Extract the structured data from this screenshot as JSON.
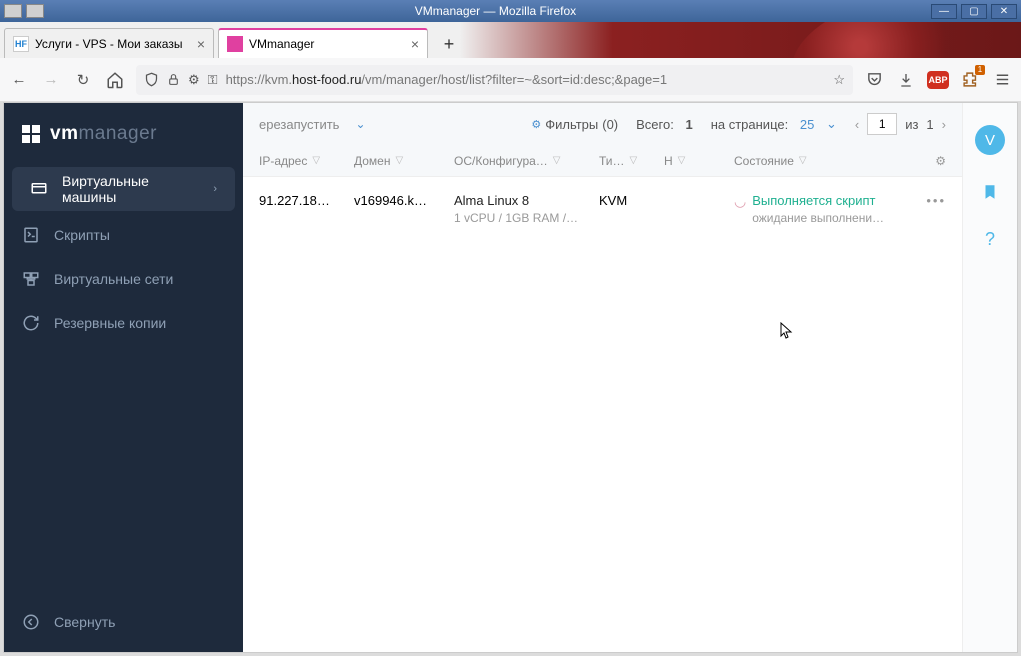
{
  "window": {
    "title": "VMmanager — Mozilla Firefox"
  },
  "tabs": [
    {
      "label": "Услуги - VPS - Мои заказы",
      "favicon": "HF"
    },
    {
      "label": "VMmanager",
      "favicon": "vm"
    }
  ],
  "url": {
    "proto": "https://",
    "pre": "kvm.",
    "host": "host-food.ru",
    "path": "/vm/manager/host/list?filter=~&sort=id:desc;&page=1"
  },
  "ext_badge": "1",
  "logo": {
    "vm": "vm",
    "mgr": "manager"
  },
  "nav": {
    "vms": "Виртуальные машины",
    "scripts": "Скрипты",
    "nets": "Виртуальные сети",
    "backups": "Резервные копии",
    "collapse": "Свернуть"
  },
  "toolbar": {
    "restart": "ерезапустить",
    "filters_label": "Фильтры",
    "filters_count": "(0)",
    "total_label": "Всего:",
    "total_value": "1",
    "perpage_label": "на странице:",
    "perpage_value": "25",
    "page_value": "1",
    "page_of": "из",
    "page_total": "1"
  },
  "columns": {
    "ip": "IP-адрес",
    "domain": "Домен",
    "os": "ОС/Конфигура…",
    "type": "Ти…",
    "h": "Н",
    "state": "Состояние"
  },
  "row": {
    "ip": "91.227.18…",
    "domain": "v169946.k…",
    "os": "Alma Linux 8",
    "config": "1 vCPU / 1GB RAM /…",
    "type": "KVM",
    "state": "Выполняется скрипт",
    "state2": "ожидание выполнени…"
  },
  "avatar": "V",
  "abp": "ABP"
}
